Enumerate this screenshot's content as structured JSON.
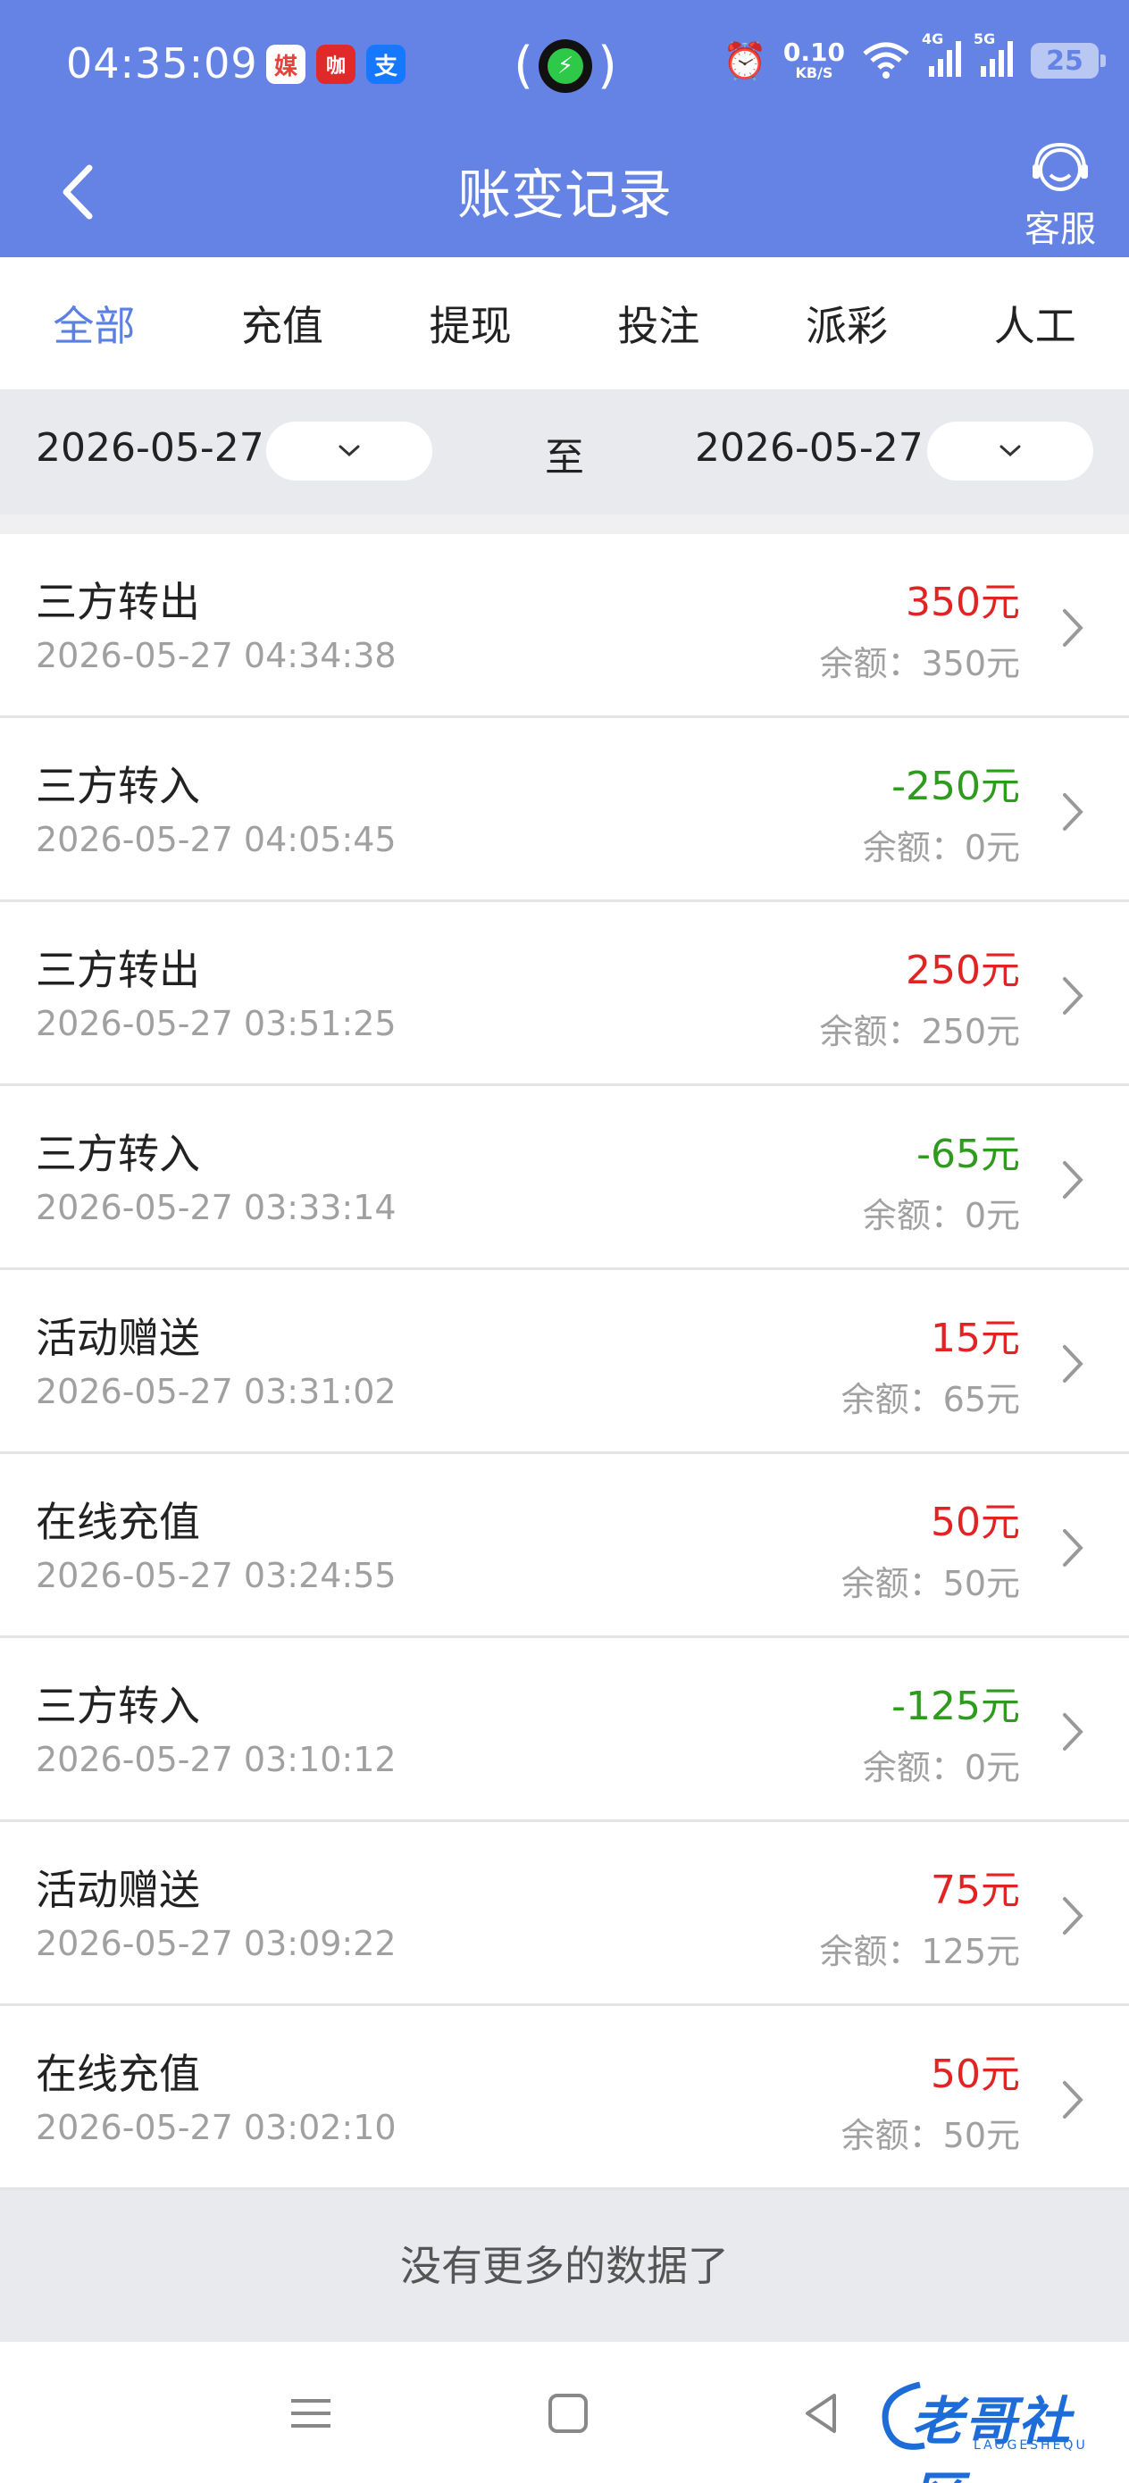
{
  "status_bar": {
    "time": "04:35:09",
    "app_icons": [
      "媒",
      "咖",
      "支"
    ],
    "network_speed": "0.10",
    "network_unit": "KB/S",
    "net_4g": "4G",
    "net_5g": "5G",
    "battery": "25"
  },
  "header": {
    "title": "账变记录",
    "service_label": "客服"
  },
  "tabs": [
    {
      "label": "全部",
      "active": true
    },
    {
      "label": "充值",
      "active": false
    },
    {
      "label": "提现",
      "active": false
    },
    {
      "label": "投注",
      "active": false
    },
    {
      "label": "派彩",
      "active": false
    },
    {
      "label": "人工",
      "active": false
    }
  ],
  "filter": {
    "start_date": "2026-05-27",
    "separator": "至",
    "end_date": "2026-05-27"
  },
  "records": [
    {
      "title": "三方转出",
      "time": "2026-05-27 04:34:38",
      "amount": "350元",
      "balance": "余额：350元",
      "type": "positive"
    },
    {
      "title": "三方转入",
      "time": "2026-05-27 04:05:45",
      "amount": "-250元",
      "balance": "余额：0元",
      "type": "negative"
    },
    {
      "title": "三方转出",
      "time": "2026-05-27 03:51:25",
      "amount": "250元",
      "balance": "余额：250元",
      "type": "positive"
    },
    {
      "title": "三方转入",
      "time": "2026-05-27 03:33:14",
      "amount": "-65元",
      "balance": "余额：0元",
      "type": "negative"
    },
    {
      "title": "活动赠送",
      "time": "2026-05-27 03:31:02",
      "amount": "15元",
      "balance": "余额：65元",
      "type": "positive"
    },
    {
      "title": "在线充值",
      "time": "2026-05-27 03:24:55",
      "amount": "50元",
      "balance": "余额：50元",
      "type": "positive"
    },
    {
      "title": "三方转入",
      "time": "2026-05-27 03:10:12",
      "amount": "-125元",
      "balance": "余额：0元",
      "type": "negative"
    },
    {
      "title": "活动赠送",
      "time": "2026-05-27 03:09:22",
      "amount": "75元",
      "balance": "余额：125元",
      "type": "positive"
    },
    {
      "title": "在线充值",
      "time": "2026-05-27 03:02:10",
      "amount": "50元",
      "balance": "余额：50元",
      "type": "positive"
    }
  ],
  "footer": {
    "no_more": "没有更多的数据了"
  },
  "watermark": {
    "text": "老哥社区",
    "sub": "LAOGESHEQU"
  },
  "colors": {
    "header_blue": "#6583e4",
    "active_tab": "#5b7fe2",
    "positive_amount": "#e02424",
    "negative_amount": "#2e9a1e"
  }
}
